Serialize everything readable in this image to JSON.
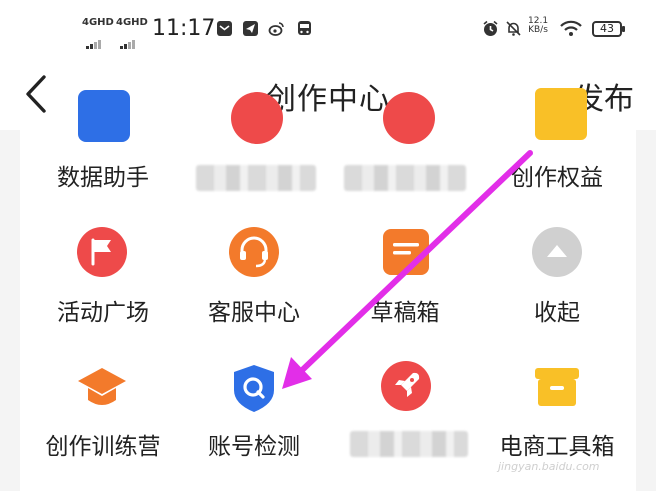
{
  "status_bar": {
    "signal_1": "4GHD",
    "signal_2": "4GHD",
    "time": "11:17",
    "speed_value": "12.1",
    "speed_unit": "KB/s",
    "battery": "43"
  },
  "nav": {
    "title": "创作中心",
    "publish_label": "发布"
  },
  "grid": {
    "row1": [
      "数据助手",
      "",
      "",
      "创作权益"
    ],
    "row2": [
      "活动广场",
      "客服中心",
      "草稿箱",
      "收起"
    ],
    "row3": [
      "创作训练营",
      "账号检测",
      "",
      "电商工具箱"
    ]
  },
  "colors": {
    "red": "#ee4a4a",
    "orange": "#f37a2b",
    "blue": "#2e6fe6",
    "yellow": "#f9c027",
    "gray": "#d0d0d0",
    "arrow": "#e22ee8"
  },
  "watermark": "jingyan.baidu.com"
}
